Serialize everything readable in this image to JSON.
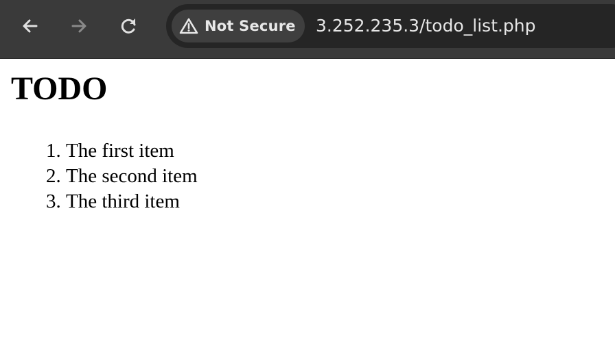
{
  "browser": {
    "nav": {
      "back_icon": "arrow-left-icon",
      "forward_icon": "arrow-right-icon",
      "reload_icon": "reload-icon"
    },
    "security_chip": {
      "icon": "warning-triangle-icon",
      "label": "Not Secure"
    },
    "url": "3.252.235.3/todo_list.php"
  },
  "page": {
    "heading": "TODO",
    "items": [
      "The first item",
      "The second item",
      "The third item"
    ]
  },
  "colors": {
    "toolbar_bg": "#3a3a3a",
    "omnibox_bg": "#252525",
    "chip_bg": "#3f3f3f",
    "icon_enabled": "#e0e0e0",
    "icon_disabled": "#8a8a8a"
  }
}
